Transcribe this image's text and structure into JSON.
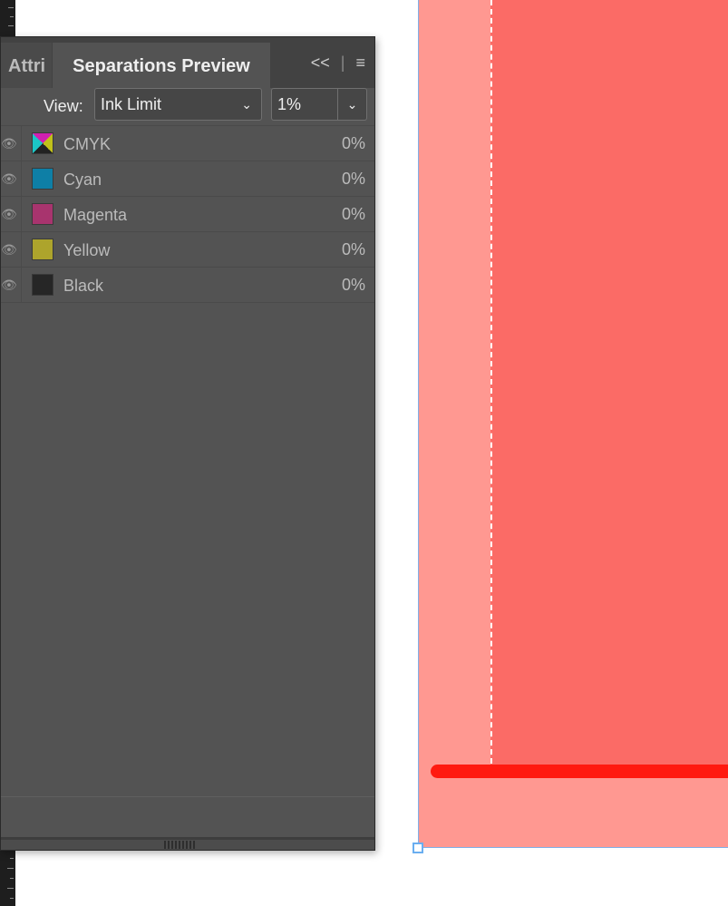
{
  "panel": {
    "tabs": [
      {
        "label": "Attri"
      },
      {
        "label": "Separations Preview"
      }
    ],
    "icons": {
      "collapse": "<<",
      "divider": "|",
      "menu": "≡"
    },
    "view_label": "View:",
    "view_value": "Ink Limit",
    "limit_value": "1%",
    "rows": [
      {
        "name": "CMYK",
        "pct": "0%",
        "color": "cmyk"
      },
      {
        "name": "Cyan",
        "pct": "0%",
        "color": "#0e7fa6"
      },
      {
        "name": "Magenta",
        "pct": "0%",
        "color": "#a8346e"
      },
      {
        "name": "Yellow",
        "pct": "0%",
        "color": "#ada42c"
      },
      {
        "name": "Black",
        "pct": "0%",
        "color": "#262626"
      }
    ]
  },
  "canvas": {
    "page_color": "#ff9891",
    "highlight_color": "#fb6b66",
    "line_color": "#ff1a10"
  }
}
